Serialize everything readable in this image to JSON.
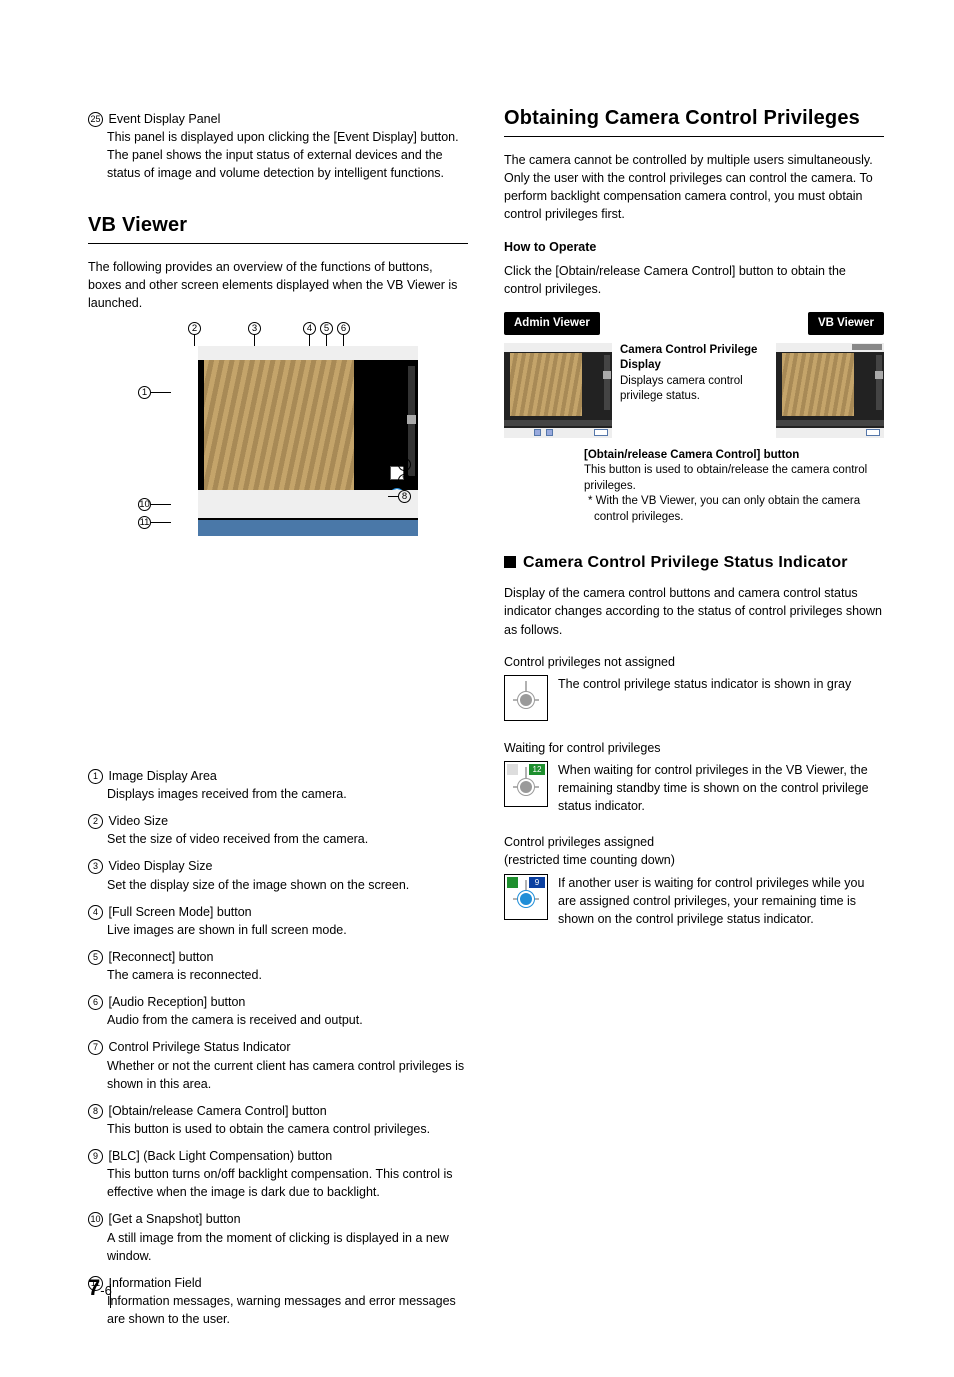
{
  "left": {
    "item25": {
      "num": "25",
      "title": "Event Display Panel",
      "body1": "This panel is displayed upon clicking the [Event Display] button.",
      "body2": "The panel shows the input status of external devices and the status of image and volume detection by intelligent functions."
    },
    "vbviewer_heading": "VB Viewer",
    "vbviewer_intro": "The following provides an overview of the functions of buttons, boxes and other screen elements displayed when the VB Viewer is launched.",
    "diagram_labels": {
      "1": "1",
      "2": "2",
      "3": "3",
      "4": "4",
      "5": "5",
      "6": "6",
      "7": "7",
      "8": "8",
      "9": "9",
      "10": "10",
      "11": "11"
    },
    "items": [
      {
        "num": "1",
        "title": "Image Display Area",
        "body": "Displays images received from the camera."
      },
      {
        "num": "2",
        "title": "Video Size",
        "body": "Set the size of video received from the camera."
      },
      {
        "num": "3",
        "title": "Video Display Size",
        "body": "Set the display size of the image shown on the screen."
      },
      {
        "num": "4",
        "title": "[Full Screen Mode] button",
        "body": "Live images are shown in full screen mode."
      },
      {
        "num": "5",
        "title": "[Reconnect] button",
        "body": "The camera is reconnected."
      },
      {
        "num": "6",
        "title": "[Audio Reception] button",
        "body": "Audio from the camera is received and output."
      },
      {
        "num": "7",
        "title": "Control Privilege Status Indicator",
        "body": "Whether or not the current client has camera control privileges is shown in this area."
      },
      {
        "num": "8",
        "title": "[Obtain/release Camera Control] button",
        "body": "This button is used to obtain the camera control privileges."
      },
      {
        "num": "9",
        "title": "[BLC] (Back Light Compensation) button",
        "body": "This button turns on/off backlight compensation. This control is effective when the image is dark due to backlight."
      },
      {
        "num": "10",
        "title": "[Get a Snapshot] button",
        "body": "A still image from the moment of clicking is displayed in a new window."
      },
      {
        "num": "11",
        "title": "Information Field",
        "body": "Information messages, warning messages and error messages are shown to the user."
      }
    ]
  },
  "right": {
    "heading": "Obtaining Camera Control Privileges",
    "intro": "The camera cannot be controlled by multiple users simultaneously. Only the user with the control privileges can control the camera. To perform backlight compensation camera control, you must obtain control privileges first.",
    "howto_label": "How to Operate",
    "howto_body": "Click the [Obtain/release Camera Control] button to obtain the control privileges.",
    "admin_label": "Admin Viewer",
    "vb_label": "VB Viewer",
    "cc_title": "Camera Control Privilege Display",
    "cc_body": "Displays camera control privilege status.",
    "ob_title": "[Obtain/release Camera Control] button",
    "ob_body": "This button is used to obtain/release the camera control privileges.",
    "ob_note": "* With the VB Viewer, you can only obtain the camera control privileges.",
    "sub_heading": "Camera Control Privilege Status Indicator",
    "sub_intro": "Display of the camera control buttons and camera control status indicator changes according to the status of control privileges shown as follows.",
    "states": [
      {
        "title": "Control privileges not assigned",
        "body": "The control privilege status indicator is shown in gray",
        "badge_right": "",
        "badge_right_bg": "",
        "dot": "#9a9a9a",
        "badge_left_bg": ""
      },
      {
        "title": "Waiting for control privileges",
        "body": "When waiting for control privileges in the VB Viewer, the remaining standby time is shown on the control privilege status indicator.",
        "badge_right": "12",
        "badge_right_bg": "#1e8f2e",
        "dot": "#9a9a9a",
        "badge_left_bg": "#ddd"
      },
      {
        "title_line1": "Control privileges assigned",
        "title_line2": "(restricted time counting down)",
        "body": "If another user is waiting for control privileges while you are assigned control privileges, your remaining time is shown on the control privilege status indicator.",
        "badge_right": "9",
        "badge_right_bg": "#0a3fa0",
        "dot": "#1f8ed8",
        "badge_left_bg": "#1e8f2e"
      }
    ]
  },
  "page_num_chapter": "7",
  "page_num_sep": "-",
  "page_num_page": "6"
}
